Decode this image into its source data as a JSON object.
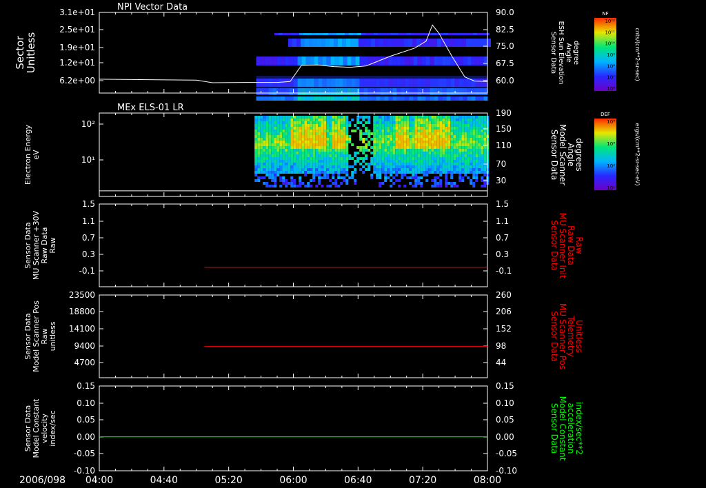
{
  "date_label": "2006/098",
  "time_ticks": [
    "04:00",
    "04:40",
    "05:20",
    "06:00",
    "06:40",
    "07:20",
    "08:00"
  ],
  "chart_data": [
    {
      "id": "p1",
      "type": "heatmap",
      "title": "NPI Vector Data",
      "left_ylabel": [
        "Sector",
        "Unitless"
      ],
      "left_ticks": [
        "3.1e+01",
        "2.5e+01",
        "1.9e+01",
        "1.2e+01",
        "6.2e+00"
      ],
      "right_ylabel": [
        "Sensor Data",
        "ESH Sun Elevation",
        "Angle",
        "degree"
      ],
      "right_ticks": [
        "90.0",
        "82.5",
        "75.0",
        "67.5",
        "60.0"
      ],
      "right_color": "#ffffff",
      "line_color": "#ffffff",
      "data_start": "05:37",
      "line": {
        "x": [
          "04:00",
          "04:30",
          "05:00",
          "05:10",
          "05:30",
          "05:50",
          "05:58",
          "06:05",
          "06:15",
          "06:25",
          "06:35",
          "06:45",
          "07:00",
          "07:15",
          "07:22",
          "07:26",
          "07:30",
          "07:38",
          "07:46",
          "07:52",
          "08:00"
        ],
        "y": [
          61.0,
          60.8,
          60.6,
          59.5,
          59.6,
          59.6,
          60.0,
          67.0,
          67.2,
          66.5,
          66.2,
          66.8,
          71.0,
          74.5,
          77.5,
          84.5,
          81.0,
          71.0,
          62.0,
          60.2,
          60.0
        ]
      },
      "colorbar": {
        "label": "NF",
        "units": "cnts/(cm**2-sr-sec)",
        "ticks": [
          "10¹²",
          "10¹¹",
          "10¹⁰",
          "10⁹",
          "10⁸",
          "10⁷",
          "10⁶"
        ]
      }
    },
    {
      "id": "p2",
      "type": "heatmap",
      "title": "MEx ELS-01 LR",
      "left_ylabel": [
        "Electron Energy",
        "eV"
      ],
      "left_ticks": [
        "10²",
        "10¹"
      ],
      "right_ylabel": [
        "Sensor Data",
        "Model Scanner",
        "Angle",
        "degrees"
      ],
      "right_ticks": [
        "190",
        "150",
        "110",
        "70",
        "30"
      ],
      "right_color": "#ffffff",
      "line_color": "#ffffff",
      "data_start": "05:36",
      "line": {
        "x": [
          "04:00",
          "08:00"
        ],
        "y": [
          22,
          22
        ]
      },
      "colorbar": {
        "label": "DEF",
        "units": "ergs/(cm**2-sr-sec-eV)",
        "ticks": [
          "10⁴",
          "10³",
          "10²",
          "10¹"
        ]
      }
    },
    {
      "id": "p3",
      "type": "line",
      "title": "",
      "left_ylabel": [
        "Sensor Data",
        "MU Scanner +30V",
        "Raw Data",
        "Raw"
      ],
      "left_ticks": [
        "1.5",
        "1.1",
        "0.7",
        "0.3",
        "-0.1"
      ],
      "right_ylabel": [
        "Sensor Data",
        "MU Scanner Init",
        "Raw Data",
        "Raw"
      ],
      "right_ticks": [
        "1.5",
        "1.1",
        "0.7",
        "0.3",
        "-0.1"
      ],
      "right_color": "#ff0000",
      "line_color": "#ff0000",
      "line": {
        "x": [
          "05:05",
          "08:00"
        ],
        "y": [
          0.0,
          0.0
        ]
      }
    },
    {
      "id": "p4",
      "type": "line",
      "title": "",
      "left_ylabel": [
        "Sensor Data",
        "Model Scanner Pos",
        "Raw",
        "unitless"
      ],
      "left_ticks": [
        "23500",
        "18800",
        "14100",
        "9400",
        "4700"
      ],
      "right_ylabel": [
        "Sensor Data",
        "MU Scanner Pos",
        "Telemetry",
        "Unitless"
      ],
      "right_ticks": [
        "260",
        "206",
        "152",
        "98",
        "44"
      ],
      "right_color": "#ff0000",
      "line_color": "#ff0000",
      "line": {
        "x": [
          "05:05",
          "08:00"
        ],
        "y": [
          105,
          105
        ]
      }
    },
    {
      "id": "p5",
      "type": "line",
      "title": "",
      "left_ylabel": [
        "Sensor Data",
        "Model Constant",
        "velocity",
        "index/sec"
      ],
      "left_ticks": [
        "0.15",
        "0.10",
        "0.05",
        "0.00",
        "-0.05",
        "-0.10"
      ],
      "right_ylabel": [
        "Sensor Data",
        "Model Constant",
        "acceleration",
        "index/sec**2"
      ],
      "right_ticks": [
        "0.15",
        "0.10",
        "0.05",
        "0.00",
        "-0.05",
        "-0.10"
      ],
      "right_color": "#00ff00",
      "line_color": "#00ff00",
      "line": {
        "x": [
          "04:00",
          "08:00"
        ],
        "y": [
          0.0,
          0.0
        ]
      }
    }
  ]
}
